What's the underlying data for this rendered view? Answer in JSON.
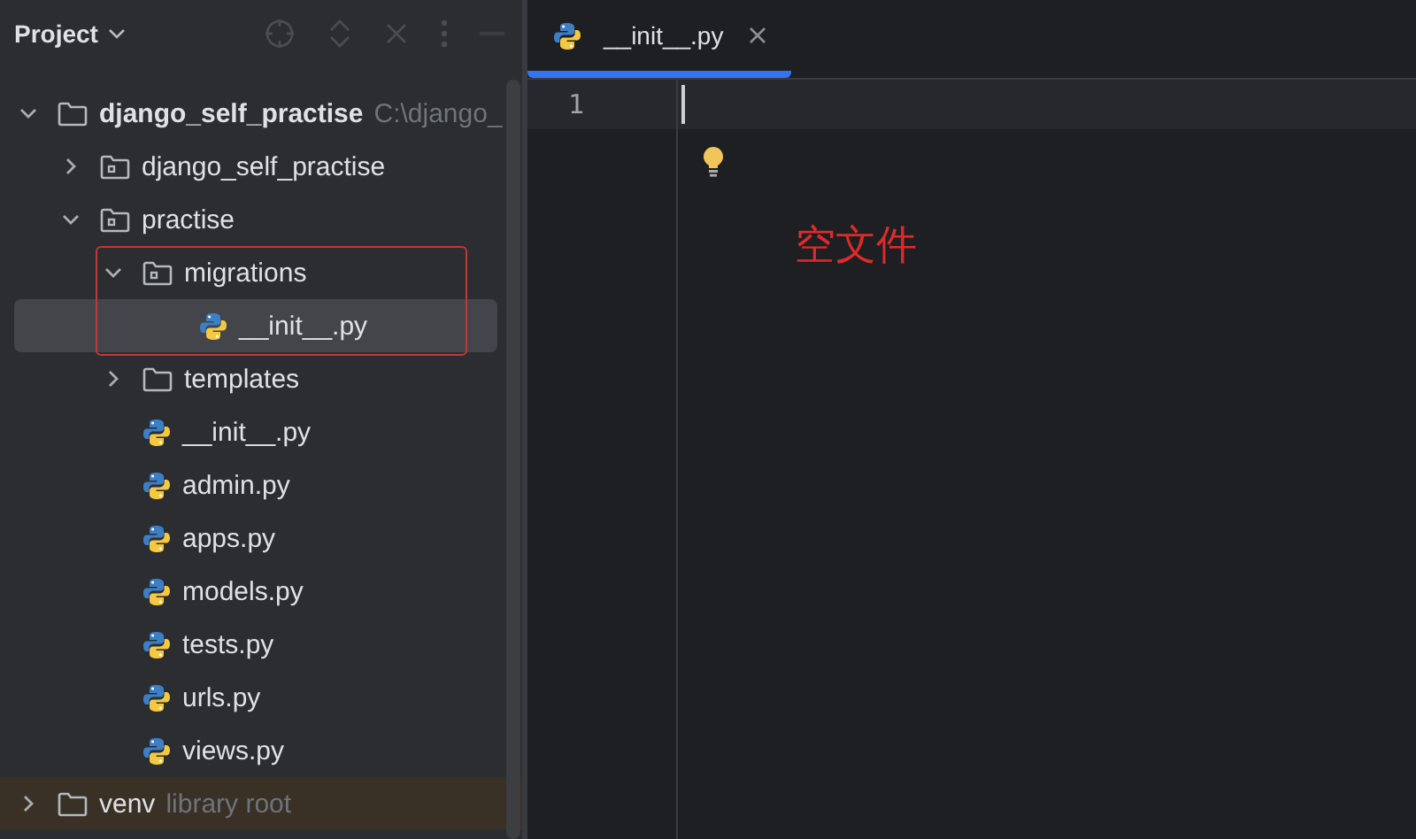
{
  "sidebar": {
    "title": "Project",
    "tree": [
      {
        "label": "django_self_practise",
        "hint": "C:\\django_",
        "kind": "folder",
        "expanded": true,
        "selected": false,
        "children": [
          {
            "label": "django_self_practise",
            "kind": "module",
            "expanded": false,
            "selected": false
          },
          {
            "label": "practise",
            "kind": "module",
            "expanded": true,
            "selected": false,
            "children": [
              {
                "label": "migrations",
                "kind": "module",
                "expanded": true,
                "selected": false,
                "children": [
                  {
                    "label": "__init__.py",
                    "kind": "python",
                    "selected": true
                  }
                ]
              },
              {
                "label": "templates",
                "kind": "folder",
                "expanded": false,
                "selected": false
              },
              {
                "label": "__init__.py",
                "kind": "python",
                "selected": false
              },
              {
                "label": "admin.py",
                "kind": "python",
                "selected": false
              },
              {
                "label": "apps.py",
                "kind": "python",
                "selected": false
              },
              {
                "label": "models.py",
                "kind": "python",
                "selected": false
              },
              {
                "label": "tests.py",
                "kind": "python",
                "selected": false
              },
              {
                "label": "urls.py",
                "kind": "python",
                "selected": false
              },
              {
                "label": "views.py",
                "kind": "python",
                "selected": false
              }
            ]
          }
        ]
      },
      {
        "label": "venv",
        "hint": "library root",
        "kind": "library",
        "expanded": false,
        "selected": false
      }
    ]
  },
  "tabs": [
    {
      "label": "__init__.py",
      "selected": true
    }
  ],
  "editor": {
    "line_numbers": [
      "1"
    ],
    "annotation": "空文件"
  }
}
